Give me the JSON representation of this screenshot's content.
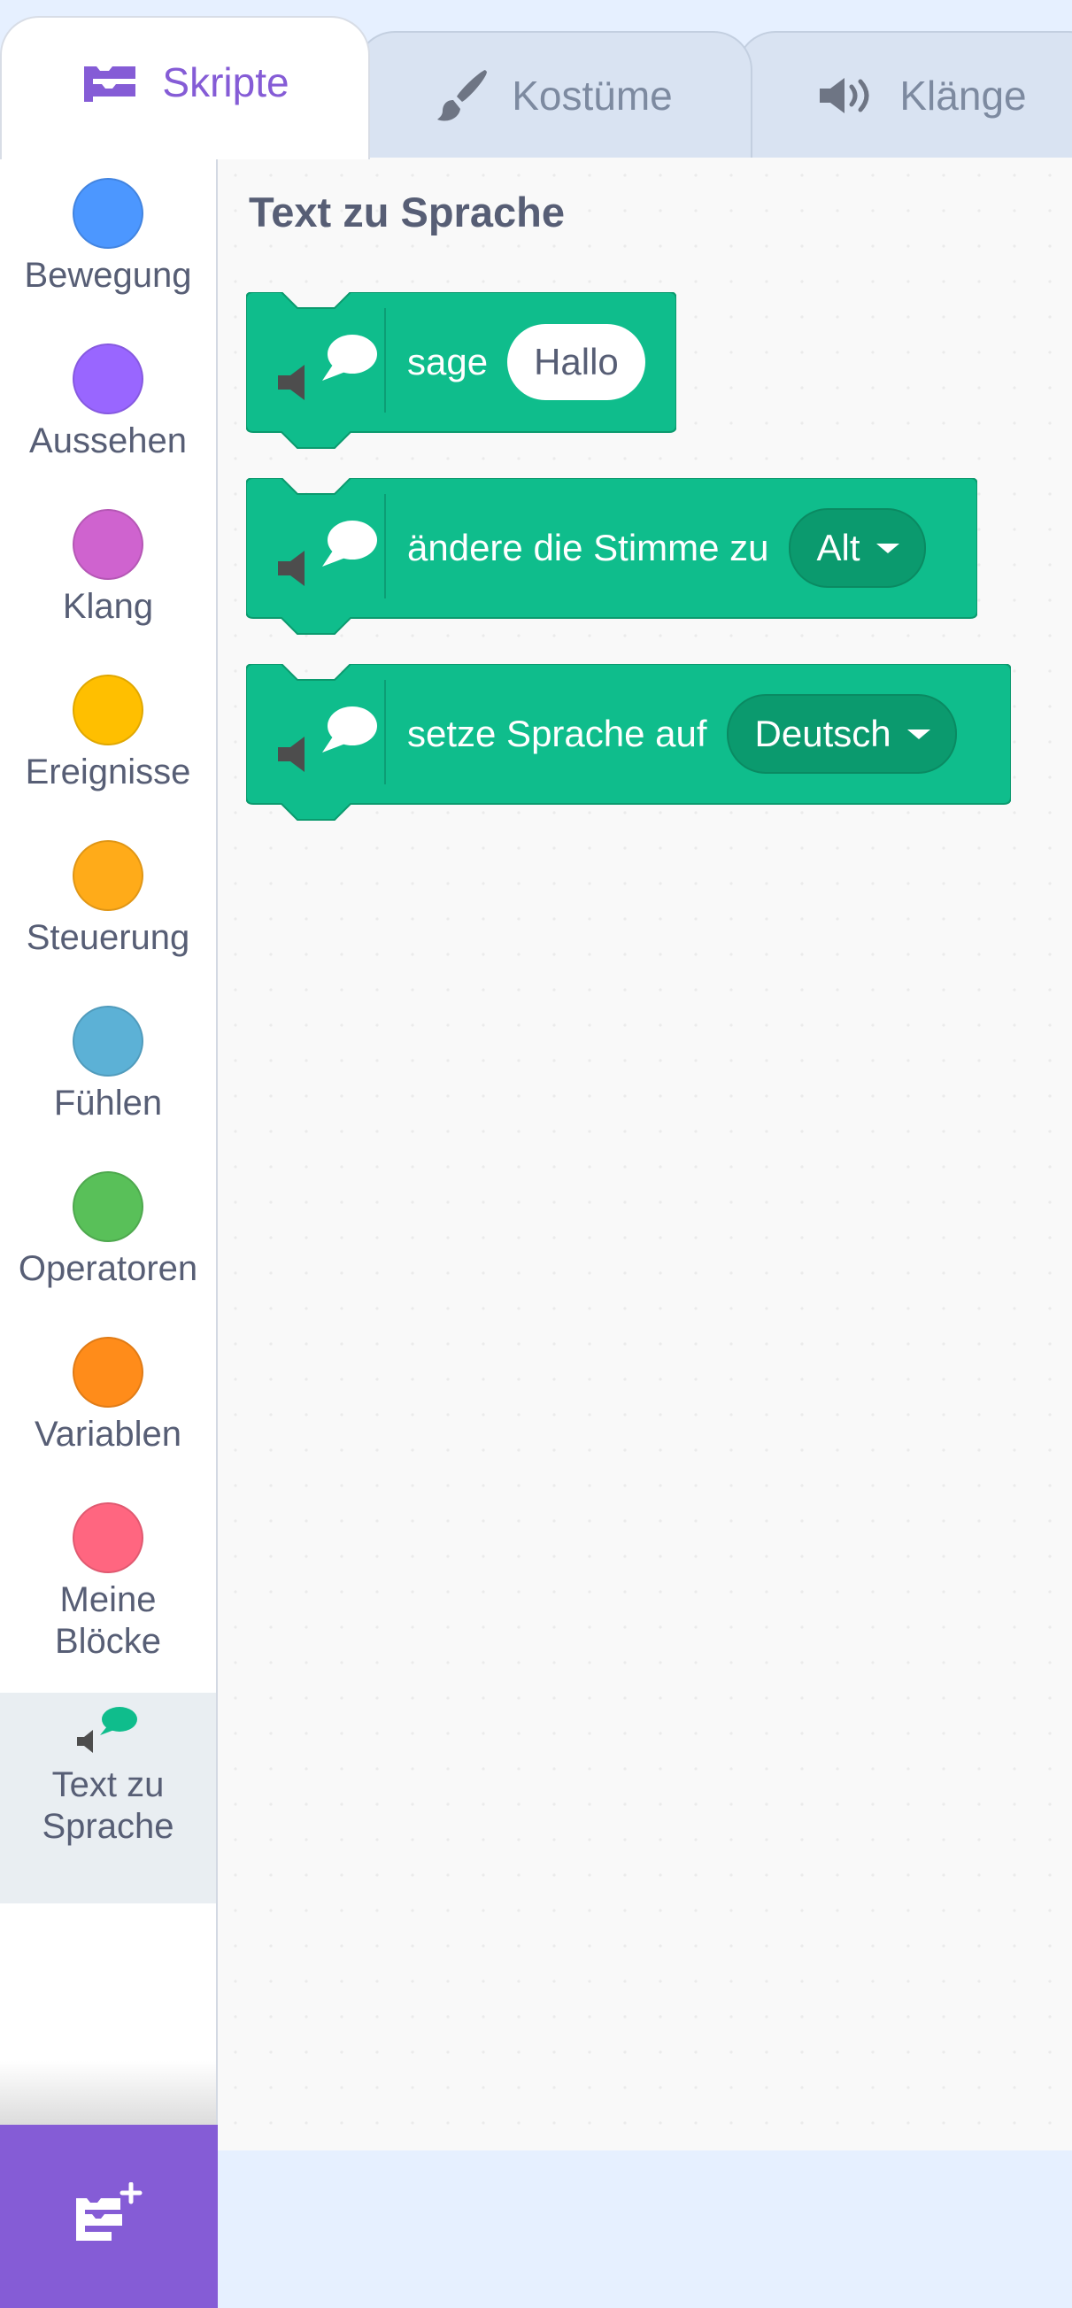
{
  "tabs": [
    {
      "label": "Skripte",
      "icon": "code-blocks-icon",
      "active": true
    },
    {
      "label": "Kostüme",
      "icon": "paintbrush-icon",
      "active": false
    },
    {
      "label": "Klänge",
      "icon": "speaker-icon",
      "active": false
    }
  ],
  "categories": [
    {
      "label": "Bewegung",
      "color": "#4c97ff"
    },
    {
      "label": "Aussehen",
      "color": "#9966ff"
    },
    {
      "label": "Klang",
      "color": "#cf63cf"
    },
    {
      "label": "Ereignisse",
      "color": "#ffbf00"
    },
    {
      "label": "Steuerung",
      "color": "#ffab19"
    },
    {
      "label": "Fühlen",
      "color": "#5cb1d6"
    },
    {
      "label": "Operatoren",
      "color": "#59c059"
    },
    {
      "label": "Variablen",
      "color": "#ff8c1a"
    },
    {
      "label": "Meine Blöcke",
      "color": "#ff6680"
    },
    {
      "label": "Text zu Sprache",
      "icon": "text-to-speech-icon",
      "selected": true
    }
  ],
  "extension_button": {
    "icon": "add-extension-icon"
  },
  "palette": {
    "heading": "Text zu Sprache",
    "block_color": "#0fbd8c",
    "blocks": [
      {
        "label": "sage",
        "input": "Hallo"
      },
      {
        "label": "ändere die Stimme zu",
        "dropdown": "Alt"
      },
      {
        "label": "setze Sprache auf",
        "dropdown": "Deutsch"
      }
    ]
  }
}
